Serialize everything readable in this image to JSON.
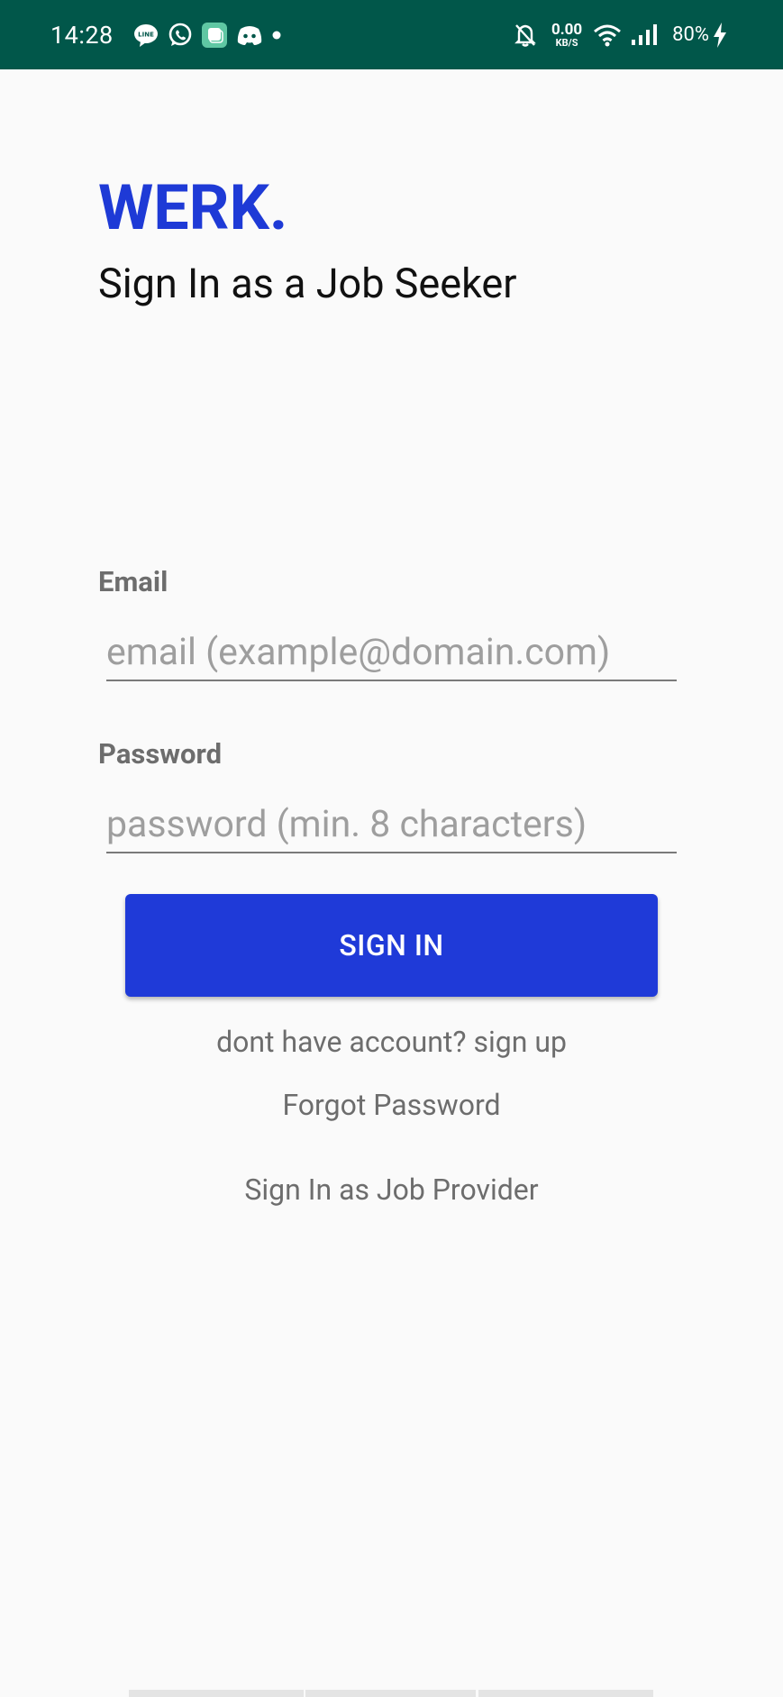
{
  "status_bar": {
    "time": "14:28",
    "net_speed_value": "0.00",
    "net_speed_unit": "KB/S",
    "battery": "80%",
    "colors": {
      "background": "#01574a"
    },
    "icons": [
      "line-app-icon",
      "whatsapp-icon",
      "app-notification-icon",
      "discord-icon",
      "dot-icon",
      "mute-bell-icon",
      "wifi-icon",
      "signal-icon",
      "charging-icon"
    ]
  },
  "header": {
    "logo": "WERK.",
    "title": "Sign In as a Job Seeker",
    "colors": {
      "brand": "#1e3ad6"
    }
  },
  "form": {
    "email_label": "Email",
    "email_placeholder": "email (example@domain.com)",
    "email_value": "",
    "password_label": "Password",
    "password_placeholder": "password (min. 8 characters)",
    "password_value": "",
    "signin_label": "SIGN IN",
    "colors": {
      "button": "#1f3ad8"
    }
  },
  "links": {
    "signup": "dont have account? sign up",
    "forgot_password": "Forgot Password",
    "provider_signin": "Sign In as Job Provider"
  }
}
